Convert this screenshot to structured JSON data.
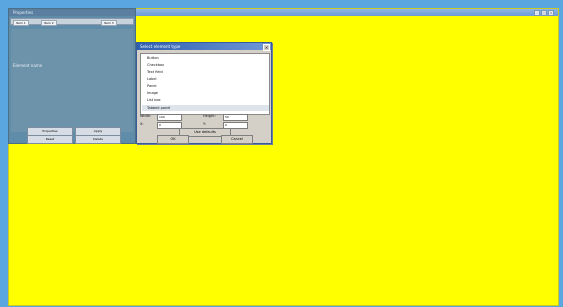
{
  "canvas": {
    "title": "",
    "controls": {
      "minimize": "–",
      "maximize": "□",
      "close": "×"
    },
    "background_color": "#ffff00"
  },
  "left_panel": {
    "title": "Properties",
    "toolbar": [
      "Item 1",
      "Item 2",
      "Item 3"
    ],
    "body_label": "Element name",
    "buttons": [
      "Properties",
      "Apply",
      "Reset",
      "Delete"
    ]
  },
  "dialog": {
    "title": "Select element type",
    "close": "×",
    "items": [
      "Button",
      "Checkbox",
      "Text field",
      "Label",
      "Panel",
      "Image",
      "List box",
      "Tabbed panel"
    ],
    "selected_index": 7,
    "fields": {
      "width_label": "Width:",
      "width_value": "100",
      "height_label": "Height:",
      "height_value": "50",
      "xpos_label": "X:",
      "xpos_value": "0",
      "ypos_label": "Y:",
      "ypos_value": "0"
    },
    "option_button": "Use defaults",
    "ok_button": "OK",
    "cancel_button": "Cancel"
  }
}
